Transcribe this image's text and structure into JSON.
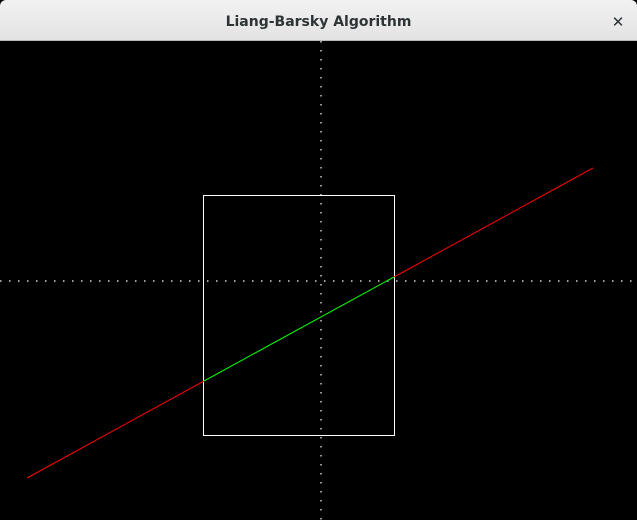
{
  "window": {
    "title": "Liang-Barsky Algorithm",
    "close_glyph": "✕"
  },
  "colors": {
    "background": "#000000",
    "axes": "#ffffff",
    "clip_window": "#ffffff",
    "outside_segment": "#ff0000",
    "inside_segment": "#00ff00"
  }
}
